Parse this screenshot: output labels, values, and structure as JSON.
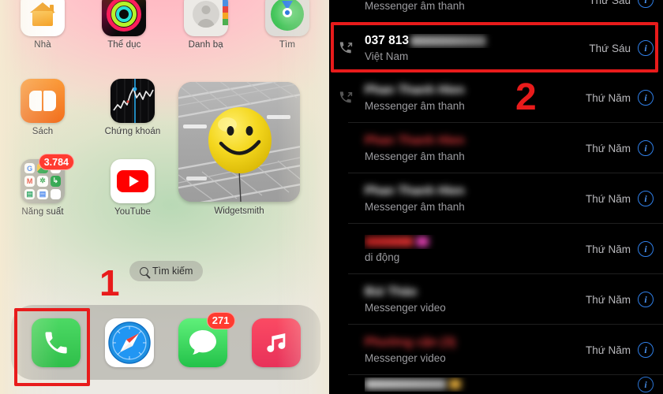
{
  "home": {
    "rows": [
      [
        {
          "label": "Nhà",
          "icon": "home-icon"
        },
        {
          "label": "Thể dục",
          "icon": "fitness-rings-icon"
        },
        {
          "label": "Danh bạ",
          "icon": "contacts-icon"
        },
        {
          "label": "Tìm",
          "icon": "find-my-icon"
        }
      ],
      [
        {
          "label": "Sách",
          "icon": "books-icon"
        },
        {
          "label": "Chứng khoán",
          "icon": "stocks-icon"
        }
      ],
      [
        {
          "label": "Năng suất",
          "icon": "folder-icon",
          "badge": "3.784"
        },
        {
          "label": "YouTube",
          "icon": "youtube-icon"
        }
      ]
    ],
    "widget": {
      "label": "Widgetsmith",
      "icon": "photo-widget"
    },
    "search": {
      "label": "Tìm kiếm",
      "icon": "search-icon"
    },
    "dock": [
      {
        "label": "Phone",
        "icon": "phone-icon"
      },
      {
        "label": "Safari",
        "icon": "safari-icon"
      },
      {
        "label": "Messages",
        "icon": "messages-icon",
        "badge": "271"
      },
      {
        "label": "Music",
        "icon": "music-icon"
      }
    ]
  },
  "annotations": {
    "step1": "1",
    "step2": "2",
    "color": "#e81b1b"
  },
  "calls": {
    "rows": [
      {
        "name": "",
        "name_hidden": true,
        "name_width": 0,
        "subtitle": "Messenger âm thanh",
        "day": "Thứ Sáu",
        "type": "missed",
        "info": "i",
        "partial_top": true
      },
      {
        "name": "037 813",
        "name_hidden": false,
        "redacted": true,
        "subtitle": "Việt Nam",
        "day": "Thứ Sáu",
        "type": "outgoing",
        "info": "i",
        "highlighted": true
      },
      {
        "name": "Phan Thanh Hien",
        "name_hidden": true,
        "name_width": 150,
        "subtitle": "Messenger âm thanh",
        "day": "Thứ Năm",
        "type": "outgoing",
        "info": "i"
      },
      {
        "name": "Phan Thanh Hien",
        "name_hidden": true,
        "name_width": 143,
        "subtitle": "Messenger âm thanh",
        "day": "Thứ Năm",
        "type": "missed",
        "missed": true,
        "info": "i"
      },
      {
        "name": "Phan Thanh Hien",
        "name_hidden": true,
        "name_width": 145,
        "subtitle": "Messenger âm thanh",
        "day": "Thứ Năm",
        "type": "none",
        "info": "i"
      },
      {
        "name": "",
        "name_hidden": true,
        "name_width": 84,
        "subtitle": "di động",
        "day": "Thứ Năm",
        "type": "none",
        "missed": true,
        "info": "i"
      },
      {
        "name": "Bùi Thảo",
        "name_hidden": true,
        "name_width": 78,
        "subtitle": "Messenger video",
        "day": "Thứ Năm",
        "type": "none",
        "info": "i"
      },
      {
        "name": "Phường cận (3)",
        "name_hidden": true,
        "name_width": 130,
        "subtitle": "Messenger video",
        "day": "Thứ Năm",
        "type": "none",
        "missed": true,
        "info": "i"
      },
      {
        "name": "",
        "name_hidden": true,
        "name_width": 120,
        "subtitle": "",
        "day": "",
        "type": "none",
        "info": "i",
        "partial_bottom": true
      }
    ],
    "info_color": "#2f7fe8",
    "missed_color": "#e6393c"
  }
}
